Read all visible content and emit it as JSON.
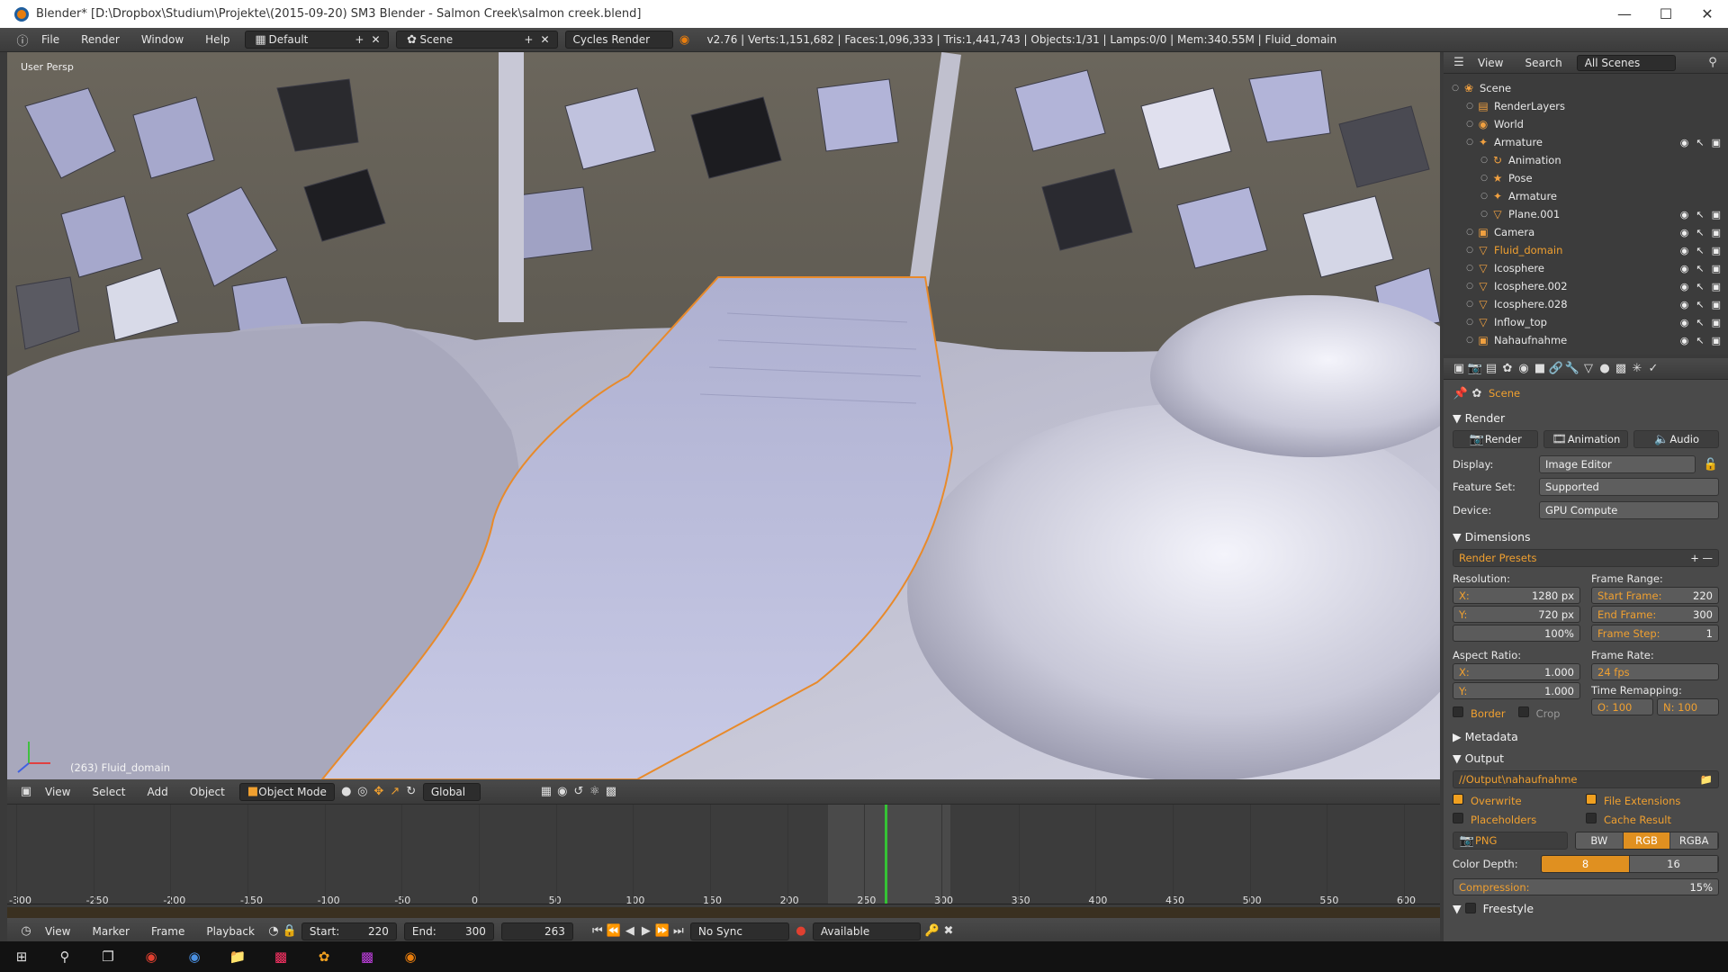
{
  "window": {
    "title": "Blender* [D:\\Dropbox\\Studium\\Projekte\\(2015-09-20) SM3 Blender - Salmon Creek\\salmon creek.blend]"
  },
  "info_header": {
    "menus": [
      "File",
      "Render",
      "Window",
      "Help"
    ],
    "layout": "Default",
    "scene": "Scene",
    "engine": "Cycles Render",
    "stats": "v2.76 | Verts:1,151,682 | Faces:1,096,333 | Tris:1,441,743 | Objects:1/31 | Lamps:0/0 | Mem:340.55M | Fluid_domain"
  },
  "viewport": {
    "view_label": "User Persp",
    "object_label": "(263) Fluid_domain",
    "header_menus": [
      "View",
      "Select",
      "Add",
      "Object"
    ],
    "mode": "Object Mode",
    "orientation": "Global"
  },
  "timeline": {
    "ticks": [
      "-300",
      "-250",
      "-200",
      "-150",
      "-100",
      "-50",
      "0",
      "50",
      "100",
      "150",
      "200",
      "250",
      "300",
      "350",
      "400",
      "450",
      "500",
      "550",
      "600"
    ],
    "current_frame_value": 263,
    "range_start": -300,
    "range_end": 600,
    "menus": [
      "View",
      "Marker",
      "Frame",
      "Playback"
    ],
    "start_label": "Start:",
    "start": "220",
    "end_label": "End:",
    "end": "300",
    "current": "263",
    "sync": "No Sync",
    "keying": "Available"
  },
  "outliner": {
    "menus": [
      "View",
      "Search",
      "All Scenes"
    ],
    "rows": [
      {
        "label": "Scene",
        "icon": "scene-icon",
        "indent": 0,
        "vis": false
      },
      {
        "label": "RenderLayers",
        "icon": "renderlayers-icon",
        "indent": 1,
        "vis": false
      },
      {
        "label": "World",
        "icon": "world-icon",
        "indent": 1,
        "vis": false
      },
      {
        "label": "Armature",
        "icon": "armature-icon",
        "indent": 1,
        "vis": true
      },
      {
        "label": "Animation",
        "icon": "animation-icon",
        "indent": 2,
        "vis": false
      },
      {
        "label": "Pose",
        "icon": "pose-icon",
        "indent": 2,
        "vis": false
      },
      {
        "label": "Armature",
        "icon": "armature-data-icon",
        "indent": 2,
        "vis": false
      },
      {
        "label": "Plane.001",
        "icon": "mesh-icon",
        "indent": 2,
        "vis": true
      },
      {
        "label": "Camera",
        "icon": "camera-icon",
        "indent": 1,
        "vis": true
      },
      {
        "label": "Fluid_domain",
        "icon": "mesh-icon",
        "indent": 1,
        "vis": true,
        "active": true
      },
      {
        "label": "Icosphere",
        "icon": "mesh-icon",
        "indent": 1,
        "vis": true
      },
      {
        "label": "Icosphere.002",
        "icon": "mesh-icon",
        "indent": 1,
        "vis": true
      },
      {
        "label": "Icosphere.028",
        "icon": "mesh-icon",
        "indent": 1,
        "vis": true
      },
      {
        "label": "Inflow_top",
        "icon": "mesh-icon",
        "indent": 1,
        "vis": true
      },
      {
        "label": "Nahaufnahme",
        "icon": "camera-icon",
        "indent": 1,
        "vis": true
      }
    ]
  },
  "properties": {
    "context": "Scene",
    "render_panel": {
      "title": "Render",
      "buttons": [
        "Render",
        "Animation",
        "Audio"
      ],
      "display_label": "Display:",
      "display": "Image Editor",
      "feature_label": "Feature Set:",
      "feature": "Supported",
      "device_label": "Device:",
      "device": "GPU Compute"
    },
    "dimensions_panel": {
      "title": "Dimensions",
      "presets": "Render Presets",
      "resolution_label": "Resolution:",
      "res_x": "1280 px",
      "res_y": "720 px",
      "res_pct": "100%",
      "frame_range_label": "Frame Range:",
      "start_frame": "220",
      "end_frame": "300",
      "frame_step": "1",
      "aspect_label": "Aspect Ratio:",
      "aspect_x": "1.000",
      "aspect_y": "1.000",
      "frame_rate_label": "Frame Rate:",
      "frame_rate": "24 fps",
      "remap_label": "Time Remapping:",
      "remap_old": "O: 100",
      "remap_new": "N: 100",
      "border": "Border",
      "crop": "Crop",
      "x_label": "X:",
      "y_label": "Y:",
      "start_label": "Start Frame:",
      "end_label": "End Frame:",
      "step_label": "Frame Step:"
    },
    "metadata_title": "Metadata",
    "output_panel": {
      "title": "Output",
      "path": "//Output\\nahaufnahme",
      "overwrite": "Overwrite",
      "file_ext": "File Extensions",
      "placeholders": "Placeholders",
      "cache": "Cache Result",
      "format": "PNG",
      "modes": [
        "BW",
        "RGB",
        "RGBA"
      ],
      "depth_label": "Color Depth:",
      "depths": [
        "8",
        "16"
      ],
      "compression_label": "Compression:",
      "compression": "15%"
    },
    "freestyle_title": "Freestyle"
  },
  "colors": {
    "accent": "#e87d0d",
    "timeline_cursor": "#35c235",
    "selection": "#f0a030"
  }
}
